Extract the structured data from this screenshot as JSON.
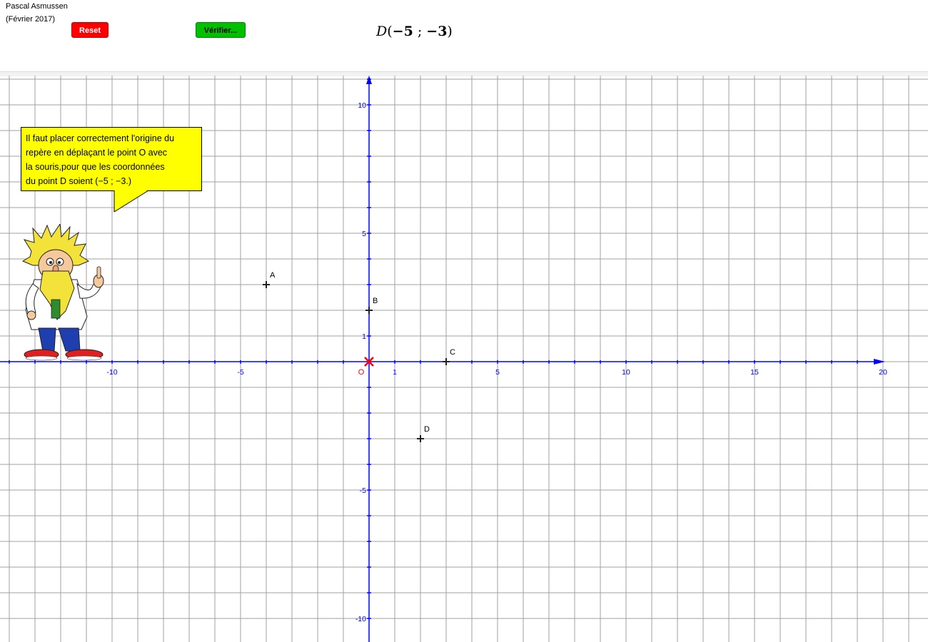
{
  "header": {
    "author": "Pascal Asmussen",
    "date": "(Février 2017)",
    "reset_label": "Reset",
    "verify_label": "Vérifier...",
    "target_point": {
      "name": "D",
      "x": "−5",
      "sep": " ; ",
      "y": "−3"
    }
  },
  "bubble": {
    "lines": [
      "Il faut placer correctement l'origine du",
      "repère en déplaçant le point O avec",
      "la souris,pour que les coordonnées",
      "du point D soient (−5 ; −3.)"
    ]
  },
  "graph": {
    "x_ticks": [
      {
        "value": -10,
        "label": "-10"
      },
      {
        "value": -5,
        "label": "-5"
      },
      {
        "value": 1,
        "label": "1"
      },
      {
        "value": 5,
        "label": "5"
      },
      {
        "value": 10,
        "label": "10"
      },
      {
        "value": 15,
        "label": "15"
      },
      {
        "value": 20,
        "label": "20"
      }
    ],
    "y_ticks": [
      {
        "value": 10,
        "label": "10"
      },
      {
        "value": 5,
        "label": "5"
      },
      {
        "value": 1,
        "label": "1"
      },
      {
        "value": -5,
        "label": "-5"
      },
      {
        "value": -10,
        "label": "-10"
      }
    ],
    "origin_label": "O",
    "points": [
      {
        "name": "A",
        "x": -4,
        "y": 3
      },
      {
        "name": "B",
        "x": 0,
        "y": 2
      },
      {
        "name": "C",
        "x": 3,
        "y": 0
      },
      {
        "name": "D",
        "x": 2,
        "y": -3
      }
    ],
    "axis_color": "#0000ff",
    "grid_color": "#a0a0a0",
    "origin_color": "#ff0000",
    "bubble_color": "#ffff00"
  }
}
